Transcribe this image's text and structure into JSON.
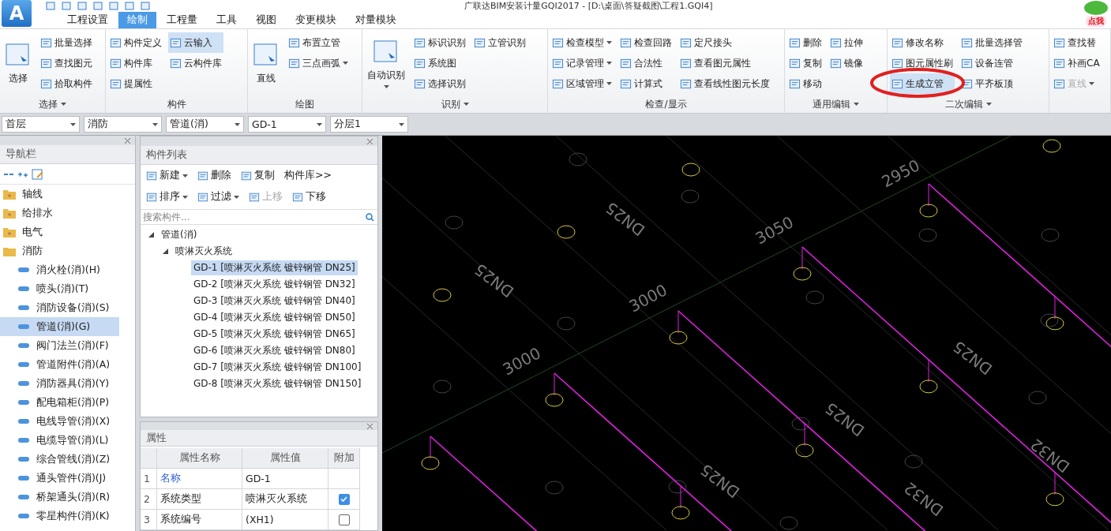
{
  "window": {
    "title": "广联达BIM安装计量GQI2017 - [D:\\桌面\\答疑截图\\工程1.GQI4]",
    "logo": "A"
  },
  "tabs": [
    {
      "label": "工程设置",
      "selected": false
    },
    {
      "label": "绘制",
      "selected": true
    },
    {
      "label": "工程量",
      "selected": false
    },
    {
      "label": "工具",
      "selected": false
    },
    {
      "label": "视图",
      "selected": false
    },
    {
      "label": "变更模块",
      "selected": false
    },
    {
      "label": "对量模块",
      "selected": false
    }
  ],
  "promo": {
    "label": "点我"
  },
  "ribbon": [
    {
      "label": "选择",
      "menu": true,
      "columns": [
        [
          {
            "label": "选择",
            "kind": "large",
            "dropdown": false,
            "highlighted": false,
            "disabled": false
          }
        ],
        [
          {
            "label": "批量选择",
            "kind": "small",
            "dropdown": false,
            "highlighted": false,
            "disabled": false
          },
          {
            "label": "查找图元",
            "kind": "small",
            "dropdown": false,
            "highlighted": false,
            "disabled": false
          },
          {
            "label": "拾取构件",
            "kind": "small",
            "dropdown": false,
            "highlighted": false,
            "disabled": false
          }
        ]
      ]
    },
    {
      "label": "构件",
      "menu": false,
      "columns": [
        [
          {
            "label": "构件定义",
            "kind": "small",
            "dropdown": false,
            "highlighted": false,
            "disabled": false
          },
          {
            "label": "构件库",
            "kind": "small",
            "dropdown": false,
            "highlighted": false,
            "disabled": false
          },
          {
            "label": "提属性",
            "kind": "small",
            "dropdown": false,
            "highlighted": false,
            "disabled": false
          }
        ],
        [
          {
            "label": "云输入",
            "kind": "small",
            "dropdown": false,
            "highlighted": true,
            "disabled": false
          },
          {
            "label": "云构件库",
            "kind": "small",
            "dropdown": false,
            "highlighted": false,
            "disabled": false
          }
        ]
      ]
    },
    {
      "label": "绘图",
      "menu": false,
      "columns": [
        [
          {
            "label": "直线",
            "kind": "large",
            "dropdown": false,
            "highlighted": false,
            "disabled": false
          }
        ],
        [
          {
            "label": "布置立管",
            "kind": "small",
            "dropdown": false,
            "highlighted": false,
            "disabled": false
          },
          {
            "label": "三点画弧",
            "kind": "small",
            "dropdown": true,
            "highlighted": false,
            "disabled": false
          }
        ]
      ]
    },
    {
      "label": "识别",
      "menu": true,
      "columns": [
        [
          {
            "label": "自动识别",
            "kind": "large",
            "dropdown": true,
            "highlighted": false,
            "disabled": false
          }
        ],
        [
          {
            "label": "标识识别",
            "kind": "small",
            "dropdown": false,
            "highlighted": false,
            "disabled": false
          },
          {
            "label": "系统图",
            "kind": "small",
            "dropdown": false,
            "highlighted": false,
            "disabled": false
          },
          {
            "label": "选择识别",
            "kind": "small",
            "dropdown": false,
            "highlighted": false,
            "disabled": false
          }
        ],
        [
          {
            "label": "立管识别",
            "kind": "small",
            "dropdown": false,
            "highlighted": false,
            "disabled": false
          }
        ]
      ]
    },
    {
      "label": "检查/显示",
      "menu": false,
      "columns": [
        [
          {
            "label": "检查模型",
            "kind": "small",
            "dropdown": true,
            "highlighted": false,
            "disabled": false
          },
          {
            "label": "记录管理",
            "kind": "small",
            "dropdown": true,
            "highlighted": false,
            "disabled": false
          },
          {
            "label": "区域管理",
            "kind": "small",
            "dropdown": true,
            "highlighted": false,
            "disabled": false
          }
        ],
        [
          {
            "label": "检查回路",
            "kind": "small",
            "dropdown": false,
            "highlighted": false,
            "disabled": false
          },
          {
            "label": "合法性",
            "kind": "small",
            "dropdown": false,
            "highlighted": false,
            "disabled": false
          },
          {
            "label": "计算式",
            "kind": "small",
            "dropdown": false,
            "highlighted": false,
            "disabled": false
          }
        ],
        [
          {
            "label": "定尺接头",
            "kind": "small",
            "dropdown": false,
            "highlighted": false,
            "disabled": false
          },
          {
            "label": "查看图元属性",
            "kind": "small",
            "dropdown": false,
            "highlighted": false,
            "disabled": false
          },
          {
            "label": "查看线性图元长度",
            "kind": "small",
            "dropdown": false,
            "highlighted": false,
            "disabled": false
          }
        ]
      ]
    },
    {
      "label": "通用编辑",
      "menu": true,
      "columns": [
        [
          {
            "label": "删除",
            "kind": "small",
            "dropdown": false,
            "highlighted": false,
            "disabled": false
          },
          {
            "label": "复制",
            "kind": "small",
            "dropdown": false,
            "highlighted": false,
            "disabled": false
          },
          {
            "label": "移动",
            "kind": "small",
            "dropdown": false,
            "highlighted": false,
            "disabled": false
          }
        ],
        [
          {
            "label": "拉伸",
            "kind": "small",
            "dropdown": false,
            "highlighted": false,
            "disabled": false
          },
          {
            "label": "镜像",
            "kind": "small",
            "dropdown": false,
            "highlighted": false,
            "disabled": false
          }
        ]
      ]
    },
    {
      "label": "二次编辑",
      "menu": true,
      "columns": [
        [
          {
            "label": "修改名称",
            "kind": "small",
            "dropdown": false,
            "highlighted": false,
            "disabled": false
          },
          {
            "label": "图元属性刷",
            "kind": "small",
            "dropdown": false,
            "highlighted": false,
            "disabled": false
          },
          {
            "label": "生成立管",
            "kind": "small",
            "dropdown": false,
            "highlighted": true,
            "disabled": false
          }
        ],
        [
          {
            "label": "批量选择管",
            "kind": "small",
            "dropdown": false,
            "highlighted": false,
            "disabled": false
          },
          {
            "label": "设备连管",
            "kind": "small",
            "dropdown": false,
            "highlighted": false,
            "disabled": false
          },
          {
            "label": "平齐板顶",
            "kind": "small",
            "dropdown": false,
            "highlighted": false,
            "disabled": false
          }
        ]
      ]
    },
    {
      "menu": false,
      "columns": [
        [
          {
            "label": "查找替",
            "kind": "small",
            "dropdown": false,
            "highlighted": false,
            "disabled": false
          },
          {
            "label": "补画CA",
            "kind": "small",
            "dropdown": false,
            "highlighted": false,
            "disabled": false
          },
          {
            "label": "直线",
            "kind": "small",
            "dropdown": true,
            "highlighted": false,
            "disabled": true
          }
        ]
      ]
    }
  ],
  "selectors": [
    "首层",
    "消防",
    "管道(消)",
    "GD-1",
    "分层1"
  ],
  "navigation": {
    "title": "导航栏",
    "items": [
      {
        "label": "轴线",
        "kind": "folder",
        "selected": false,
        "expanded": false
      },
      {
        "label": "给排水",
        "kind": "folder",
        "selected": false,
        "expanded": false
      },
      {
        "label": "电气",
        "kind": "folder",
        "selected": false,
        "expanded": false
      },
      {
        "label": "消防",
        "kind": "folder",
        "selected": false,
        "expanded": true,
        "children": [
          {
            "label": "消火栓(消)(H)",
            "kind": "item",
            "selected": false
          },
          {
            "label": "喷头(消)(T)",
            "kind": "item",
            "selected": false
          },
          {
            "label": "消防设备(消)(S)",
            "kind": "item",
            "selected": false
          },
          {
            "label": "管道(消)(G)",
            "kind": "item",
            "selected": true
          },
          {
            "label": "阀门法兰(消)(F)",
            "kind": "item",
            "selected": false
          },
          {
            "label": "管道附件(消)(A)",
            "kind": "item",
            "selected": false
          },
          {
            "label": "消防器具(消)(Y)",
            "kind": "item",
            "selected": false
          },
          {
            "label": "配电箱柜(消)(P)",
            "kind": "item",
            "selected": false
          },
          {
            "label": "电线导管(消)(X)",
            "kind": "item",
            "selected": false
          },
          {
            "label": "电缆导管(消)(L)",
            "kind": "item",
            "selected": false
          },
          {
            "label": "综合管线(消)(Z)",
            "kind": "item",
            "selected": false
          },
          {
            "label": "通头管件(消)(J)",
            "kind": "item",
            "selected": false
          },
          {
            "label": "桥架通头(消)(R)",
            "kind": "item",
            "selected": false
          },
          {
            "label": "零星构件(消)(K)",
            "kind": "item",
            "selected": false
          }
        ]
      }
    ]
  },
  "component_list": {
    "title": "构件列表",
    "toolbar": [
      {
        "label": "新建",
        "dropdown": true,
        "disabled": false
      },
      {
        "label": "删除",
        "dropdown": false,
        "disabled": false
      },
      {
        "label": "复制",
        "dropdown": false,
        "disabled": false
      },
      {
        "label": "构件库>>",
        "dropdown": false,
        "disabled": false
      }
    ],
    "toolbar2": [
      {
        "label": "排序",
        "dropdown": true,
        "disabled": false
      },
      {
        "label": "过滤",
        "dropdown": true,
        "disabled": false
      },
      {
        "label": "上移",
        "dropdown": false,
        "disabled": true
      },
      {
        "label": "下移",
        "dropdown": false,
        "disabled": false
      }
    ],
    "search": {
      "placeholder": "搜索构件..."
    },
    "tree": [
      {
        "label": "管道(消)",
        "selected": false,
        "expanded": true,
        "children": [
          {
            "label": "喷淋灭火系统",
            "selected": false,
            "expanded": true,
            "children": [
              {
                "label": "GD-1 [喷淋灭火系统 镀锌钢管 DN25]",
                "selected": true
              },
              {
                "label": "GD-2 [喷淋灭火系统 镀锌钢管 DN32]",
                "selected": false
              },
              {
                "label": "GD-3 [喷淋灭火系统 镀锌钢管 DN40]",
                "selected": false
              },
              {
                "label": "GD-4 [喷淋灭火系统 镀锌钢管 DN50]",
                "selected": false
              },
              {
                "label": "GD-5 [喷淋灭火系统 镀锌钢管 DN65]",
                "selected": false
              },
              {
                "label": "GD-6 [喷淋灭火系统 镀锌钢管 DN80]",
                "selected": false
              },
              {
                "label": "GD-7 [喷淋灭火系统 镀锌钢管 DN100]",
                "selected": false
              },
              {
                "label": "GD-8 [喷淋灭火系统 镀锌钢管 DN150]",
                "selected": false
              }
            ]
          }
        ]
      }
    ]
  },
  "properties": {
    "title": "属性",
    "columns": [
      "属性名称",
      "属性值",
      "附加"
    ],
    "rows": [
      {
        "index": "1",
        "name": "名称",
        "value": "GD-1",
        "kind": "link"
      },
      {
        "index": "2",
        "name": "系统类型",
        "value": "喷淋灭火系统",
        "kind": "check",
        "checked": true
      },
      {
        "index": "3",
        "name": "系统编号",
        "value": "(XH1)",
        "kind": "check",
        "checked": false
      }
    ]
  },
  "canvas": {
    "labels": [
      {
        "text": "2950",
        "kind": "dimension"
      },
      {
        "text": "3050",
        "kind": "dimension"
      },
      {
        "text": "3000",
        "kind": "dimension"
      },
      {
        "text": "3000",
        "kind": "dimension"
      },
      {
        "text": "DN25",
        "kind": "pipe_size"
      },
      {
        "text": "DN25",
        "kind": "pipe_size"
      },
      {
        "text": "DN25",
        "kind": "pipe_size"
      },
      {
        "text": "DN25",
        "kind": "pipe_size"
      },
      {
        "text": "DN25",
        "kind": "pipe_size"
      },
      {
        "text": "DN32",
        "kind": "pipe_size"
      },
      {
        "text": "DN32",
        "kind": "pipe_size"
      }
    ]
  }
}
